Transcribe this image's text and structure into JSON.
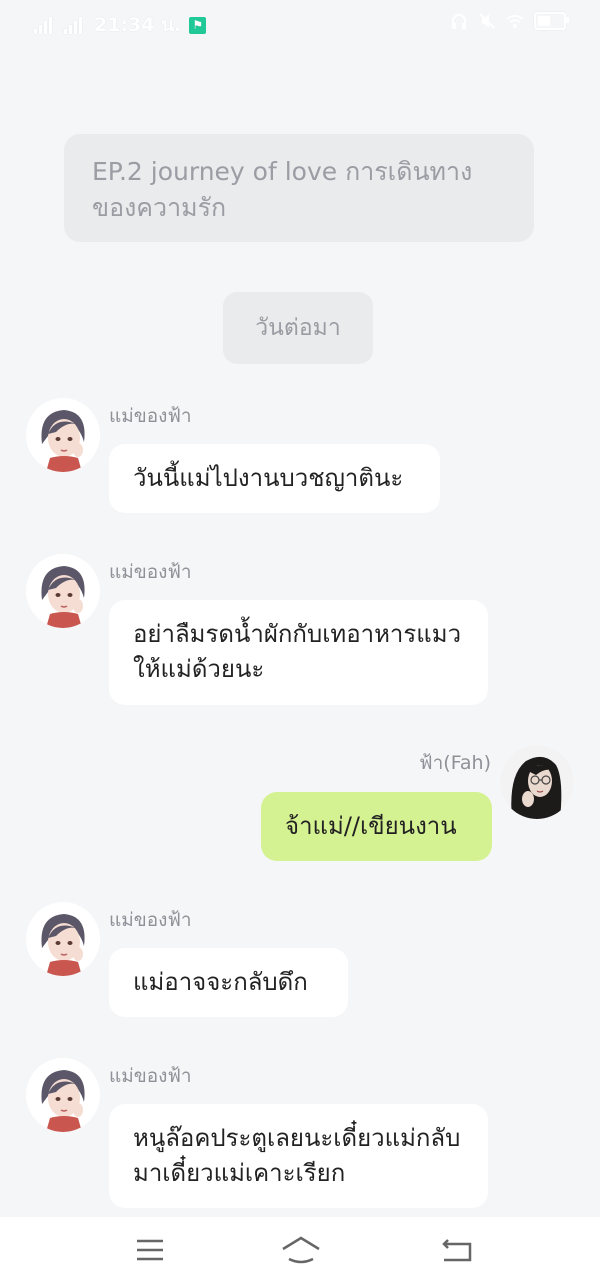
{
  "status_bar": {
    "time": "21:34 น.",
    "net_1": "4G",
    "net_2": "4G",
    "battery": "51"
  },
  "chat": {
    "episode_notice": "EP.2 journey of love การเดินทางของความรัก",
    "date_separator": "วันต่อมา",
    "messages": [
      {
        "sender": "แม่ของฟ้า",
        "text": "วันนี้แม่ไปงานบวชญาตินะ",
        "side": "left"
      },
      {
        "sender": "แม่ของฟ้า",
        "text": "อย่าลืมรดน้ำผักกับเทอาหารแมวให้แม่ด้วยนะ",
        "side": "left"
      },
      {
        "sender": "ฟ้า(Fah)",
        "text": "จ้าแม่//เขียนงาน",
        "side": "right"
      },
      {
        "sender": "แม่ของฟ้า",
        "text": "แม่อาจจะกลับดึก",
        "side": "left"
      },
      {
        "sender": "แม่ของฟ้า",
        "text": "หนูล๊อคประตูเลยนะเดี๋ยวแม่กลับมาเดี๋ยวแม่เคาะเรียก",
        "side": "left"
      }
    ]
  },
  "nav": {
    "menu_icon": "menu-icon",
    "home_icon": "home-icon",
    "back_icon": "back-icon"
  },
  "colors": {
    "background": "#f5f6f8",
    "bubble_other": "#ffffff",
    "bubble_me": "#d5f293",
    "notice_bg": "#eaebed"
  }
}
